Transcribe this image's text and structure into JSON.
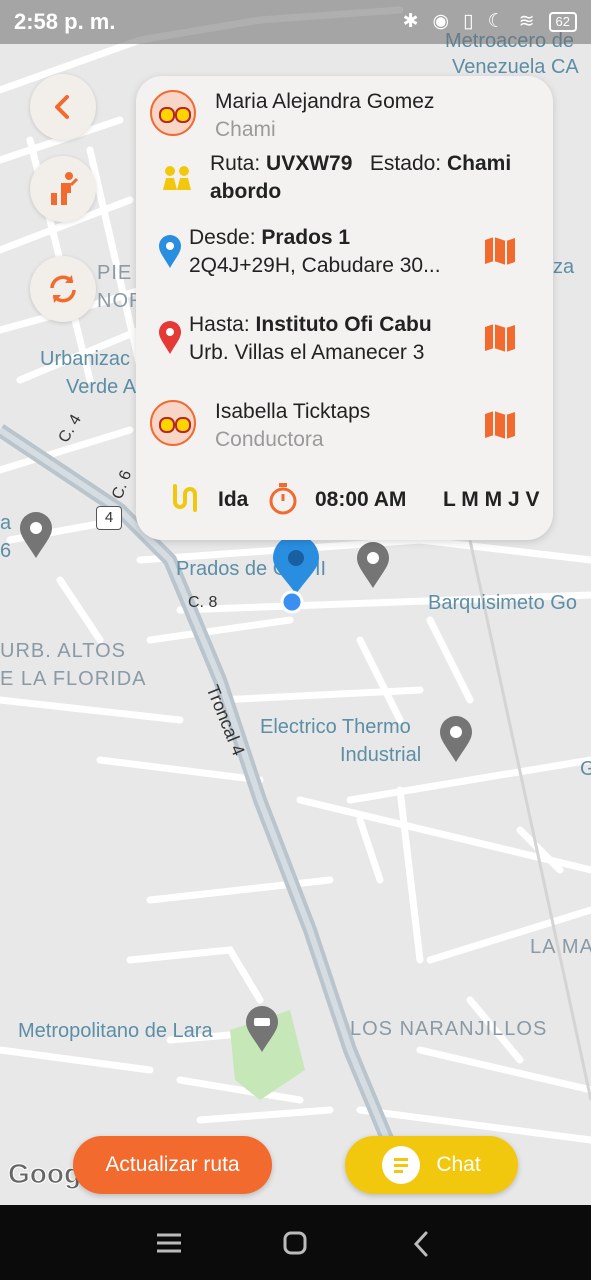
{
  "status_bar": {
    "time": "2:58 p. m.",
    "battery": "62"
  },
  "map": {
    "labels": {
      "metro_line1": "Metroacero de",
      "metro_line2": "Venezuela CA",
      "pie": "PIE",
      "nor": "NOR",
      "urbaniza": "Urbanizac",
      "verde": "Verde A",
      "za": "za",
      "c4": "C. 4",
      "c6": "C. 6",
      "a": "a",
      "six": "6",
      "four": "4",
      "prados": "Prados de Golf II",
      "c8": "C. 8",
      "barquisimeto": "Barquisimeto Go",
      "altos": "URB. ALTOS",
      "florida": "E LA FLORIDA",
      "troncal": "Troncal 4",
      "electrico1": "Electrico Thermo",
      "electrico2": "Industrial",
      "g": "G",
      "la_ma": "LA MA",
      "metropolitano": "Metropolitano de Lara",
      "naranjillos": "LOS NARANJILLOS",
      "google": "Google"
    }
  },
  "card": {
    "passenger_name": "Maria Alejandra Gomez",
    "passenger_brand": "Chami",
    "ruta_label": "Ruta:",
    "ruta_value": "UVXW79",
    "estado_label": "Estado:",
    "estado_value_1": "Chami",
    "estado_value_2": "abordo",
    "desde_label": "Desde:",
    "desde_value": "Prados 1",
    "desde_address": "2Q4J+29H, Cabudare 30...",
    "hasta_label": "Hasta:",
    "hasta_value": "Instituto Ofi Cabu",
    "hasta_address": "Urb. Villas el Amanecer 3",
    "driver_name": "Isabella Ticktaps",
    "driver_role": "Conductora",
    "trip_type": "Ida",
    "time": "08:00 AM",
    "days": "L M M J V"
  },
  "buttons": {
    "update_route": "Actualizar ruta",
    "chat": "Chat"
  },
  "colors": {
    "accent": "#f26a2e",
    "chat": "#f2c80f",
    "pin_blue": "#2a8ee0",
    "pin_red": "#e53935"
  }
}
